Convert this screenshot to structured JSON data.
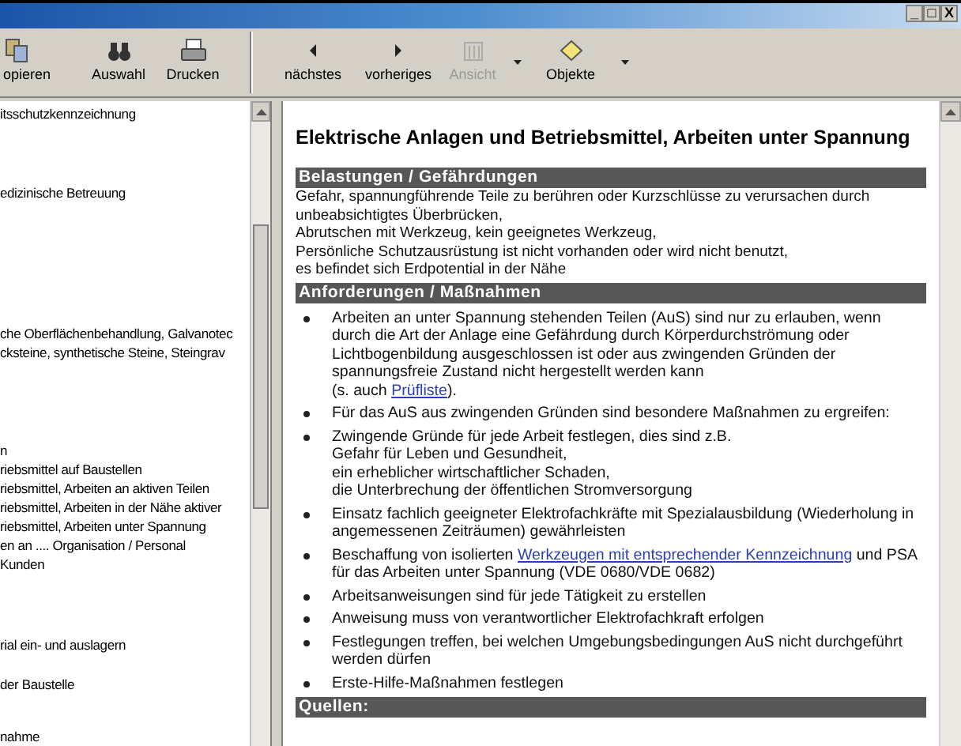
{
  "window": {
    "controls": [
      "_",
      "□",
      "X"
    ]
  },
  "toolbar": [
    {
      "kind": "button",
      "label": "opieren",
      "disabled": false
    },
    {
      "kind": "button",
      "label": "Auswahl",
      "disabled": false
    },
    {
      "kind": "button",
      "label": "Drucken",
      "disabled": false
    },
    {
      "kind": "separator"
    },
    {
      "kind": "button",
      "label": "nächstes",
      "disabled": false
    },
    {
      "kind": "button",
      "label": "vorheriges",
      "disabled": false
    },
    {
      "kind": "button",
      "label": "Ansicht",
      "disabled": true,
      "dropdown": true
    },
    {
      "kind": "button",
      "label": "Objekte",
      "disabled": false,
      "dropdown": true
    }
  ],
  "sidebar": {
    "items": [
      "itsschutzkennzeichnung",
      "edizinische Betreuung",
      "che Oberflächenbehandlung, Galvanotec",
      "cksteine, synthetische Steine, Steingrav",
      "n",
      "riebsmittel auf Baustellen",
      "riebsmittel, Arbeiten an aktiven Teilen",
      "riebsmittel, Arbeiten in der Nähe aktiver",
      "riebsmittel, Arbeiten unter Spannung",
      "en an .... Organisation / Personal",
      "Kunden",
      "rial ein- und auslagern",
      "der Baustelle",
      "nahme"
    ]
  },
  "document": {
    "title": "Elektrische Anlagen und Betriebsmittel, Arbeiten unter Spannung",
    "sections": [
      {
        "heading": "Belastungen / Gefährdungen",
        "kind": "lines",
        "lines": [
          "Gefahr, spannungführende Teile zu berühren oder Kurzschlüsse zu verursachen durch",
          "unbeabsichtigtes Überbrücken,",
          "Abrutschen mit Werkzeug, kein geeignetes Werkzeug,",
          "Persönliche Schutzausrüstung ist nicht vorhanden oder wird nicht benutzt,",
          "es befindet sich Erdpotential in der Nähe"
        ]
      },
      {
        "heading": "Anforderungen / Maßnahmen",
        "kind": "bullets",
        "bullets": [
          {
            "parts": [
              {
                "text": "Arbeiten an unter Spannung stehenden Teilen (AuS) sind nur zu erlauben, wenn durch die Art der Anlage eine Gefährdung durch Körperdurchströmung oder Lichtbogenbildung ausgeschlossen ist oder aus zwingenden Gründen der spannungsfreie Zustand nicht hergestellt werden kann"
              },
              {
                "text": "(s. auch ",
                "break": true
              },
              {
                "text": "Prüfliste",
                "link": true
              },
              {
                "text": ")."
              }
            ]
          },
          {
            "parts": [
              {
                "text": "Für das AuS aus zwingenden Gründen sind besondere Maßnahmen zu ergreifen:"
              }
            ]
          },
          {
            "parts": [
              {
                "text": "Zwingende Gründe für jede Arbeit festlegen, dies sind z.B."
              },
              {
                "text": "Gefahr für Leben und Gesundheit,",
                "break": true
              },
              {
                "text": "ein erheblicher wirtschaftlicher Schaden,",
                "break": true
              },
              {
                "text": "die Unterbrechung der öffentlichen Stromversorgung",
                "break": true
              }
            ]
          },
          {
            "parts": [
              {
                "text": "Einsatz fachlich geeigneter Elektrofachkräfte mit Spezialausbildung (Wiederholung in angemessenen Zeiträumen) gewährleisten"
              }
            ]
          },
          {
            "parts": [
              {
                "text": "Beschaffung von isolierten "
              },
              {
                "text": "Werkzeugen mit entsprechender Kennzeichnung",
                "link": true
              },
              {
                "text": " und PSA für das Arbeiten unter Spannung (VDE 0680/VDE 0682)"
              }
            ]
          },
          {
            "parts": [
              {
                "text": "Arbeitsanweisungen sind für jede Tätigkeit zu erstellen"
              }
            ]
          },
          {
            "parts": [
              {
                "text": "Anweisung muss von verantwortlicher Elektrofachkraft erfolgen"
              }
            ]
          },
          {
            "parts": [
              {
                "text": "Festlegungen treffen, bei welchen Umgebungsbedingungen AuS nicht durchgeführt werden dürfen"
              }
            ]
          },
          {
            "parts": [
              {
                "text": "Erste-Hilfe-Maßnahmen festlegen"
              }
            ]
          }
        ]
      },
      {
        "heading": "Quellen:",
        "kind": "lines"
      }
    ]
  }
}
